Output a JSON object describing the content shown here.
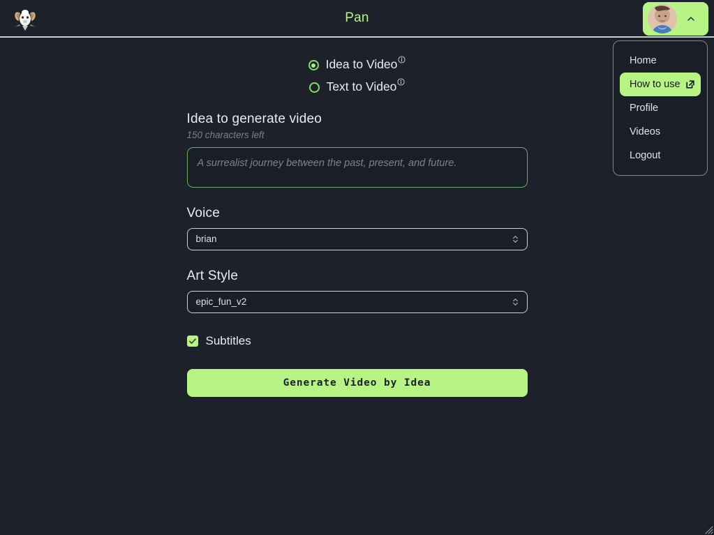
{
  "header": {
    "title": "Pan",
    "logo_icon": "ram-head-logo-icon",
    "avatar_icon": "user-avatar",
    "chevron_icon": "chevron-up-icon"
  },
  "menu": {
    "items": [
      {
        "label": "Home",
        "active": false,
        "icon": ""
      },
      {
        "label": "How to use",
        "active": true,
        "icon": "external-link-icon"
      },
      {
        "label": "Profile",
        "active": false,
        "icon": ""
      },
      {
        "label": "Videos",
        "active": false,
        "icon": ""
      },
      {
        "label": "Logout",
        "active": false,
        "icon": ""
      }
    ]
  },
  "mode": {
    "options": [
      {
        "label": "Idea to Video",
        "selected": true,
        "info_icon": "info-circle-icon"
      },
      {
        "label": "Text to Video",
        "selected": false,
        "info_icon": "info-circle-icon"
      }
    ]
  },
  "form": {
    "idea": {
      "label": "Idea to generate video",
      "hint": "150 characters left",
      "value": "",
      "placeholder": "A surrealist journey between the past, present, and future."
    },
    "voice": {
      "label": "Voice",
      "value": "brian",
      "options": [
        "brian"
      ]
    },
    "art_style": {
      "label": "Art Style",
      "value": "epic_fun_v2",
      "options": [
        "epic_fun_v2"
      ]
    },
    "subtitles": {
      "label": "Subtitles",
      "checked": true
    },
    "submit_label": "Generate Video by Idea"
  },
  "colors": {
    "accent_green": "#b8f386",
    "background": "#1d2129",
    "panel": "#1a1f27",
    "text": "#e9edf2",
    "muted_text": "#76818f"
  }
}
